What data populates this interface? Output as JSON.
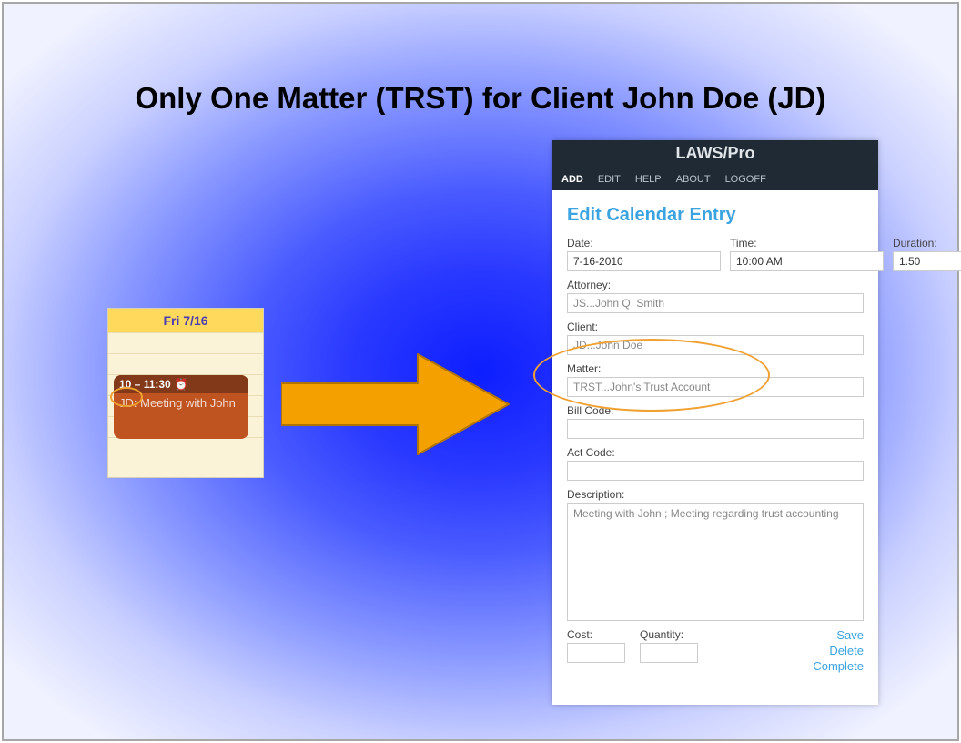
{
  "slide": {
    "title": "Only One Matter (TRST) for Client John Doe (JD)"
  },
  "calendar": {
    "day_header": "Fri 7/16",
    "event": {
      "time_range": "10 – 11:30",
      "title": "JD: Meeting with John"
    }
  },
  "app": {
    "title": "LAWS/Pro",
    "menu": [
      "ADD",
      "EDIT",
      "HELP",
      "ABOUT",
      "LOGOFF"
    ]
  },
  "form": {
    "title": "Edit Calendar Entry",
    "labels": {
      "date": "Date:",
      "time": "Time:",
      "duration": "Duration:",
      "attorney": "Attorney:",
      "client": "Client:",
      "matter": "Matter:",
      "bill_code": "Bill Code:",
      "act_code": "Act Code:",
      "description": "Description:",
      "cost": "Cost:",
      "quantity": "Quantity:"
    },
    "values": {
      "date": "7-16-2010",
      "time": "10:00 AM",
      "duration": "1.50",
      "attorney": "JS...John Q. Smith",
      "client": "JD...John Doe",
      "matter": "TRST...John's Trust Account",
      "bill_code": "",
      "act_code": "",
      "description": "Meeting with John ; Meeting regarding trust accounting",
      "cost": "",
      "quantity": ""
    },
    "actions": {
      "save": "Save",
      "delete": "Delete",
      "complete": "Complete"
    }
  }
}
